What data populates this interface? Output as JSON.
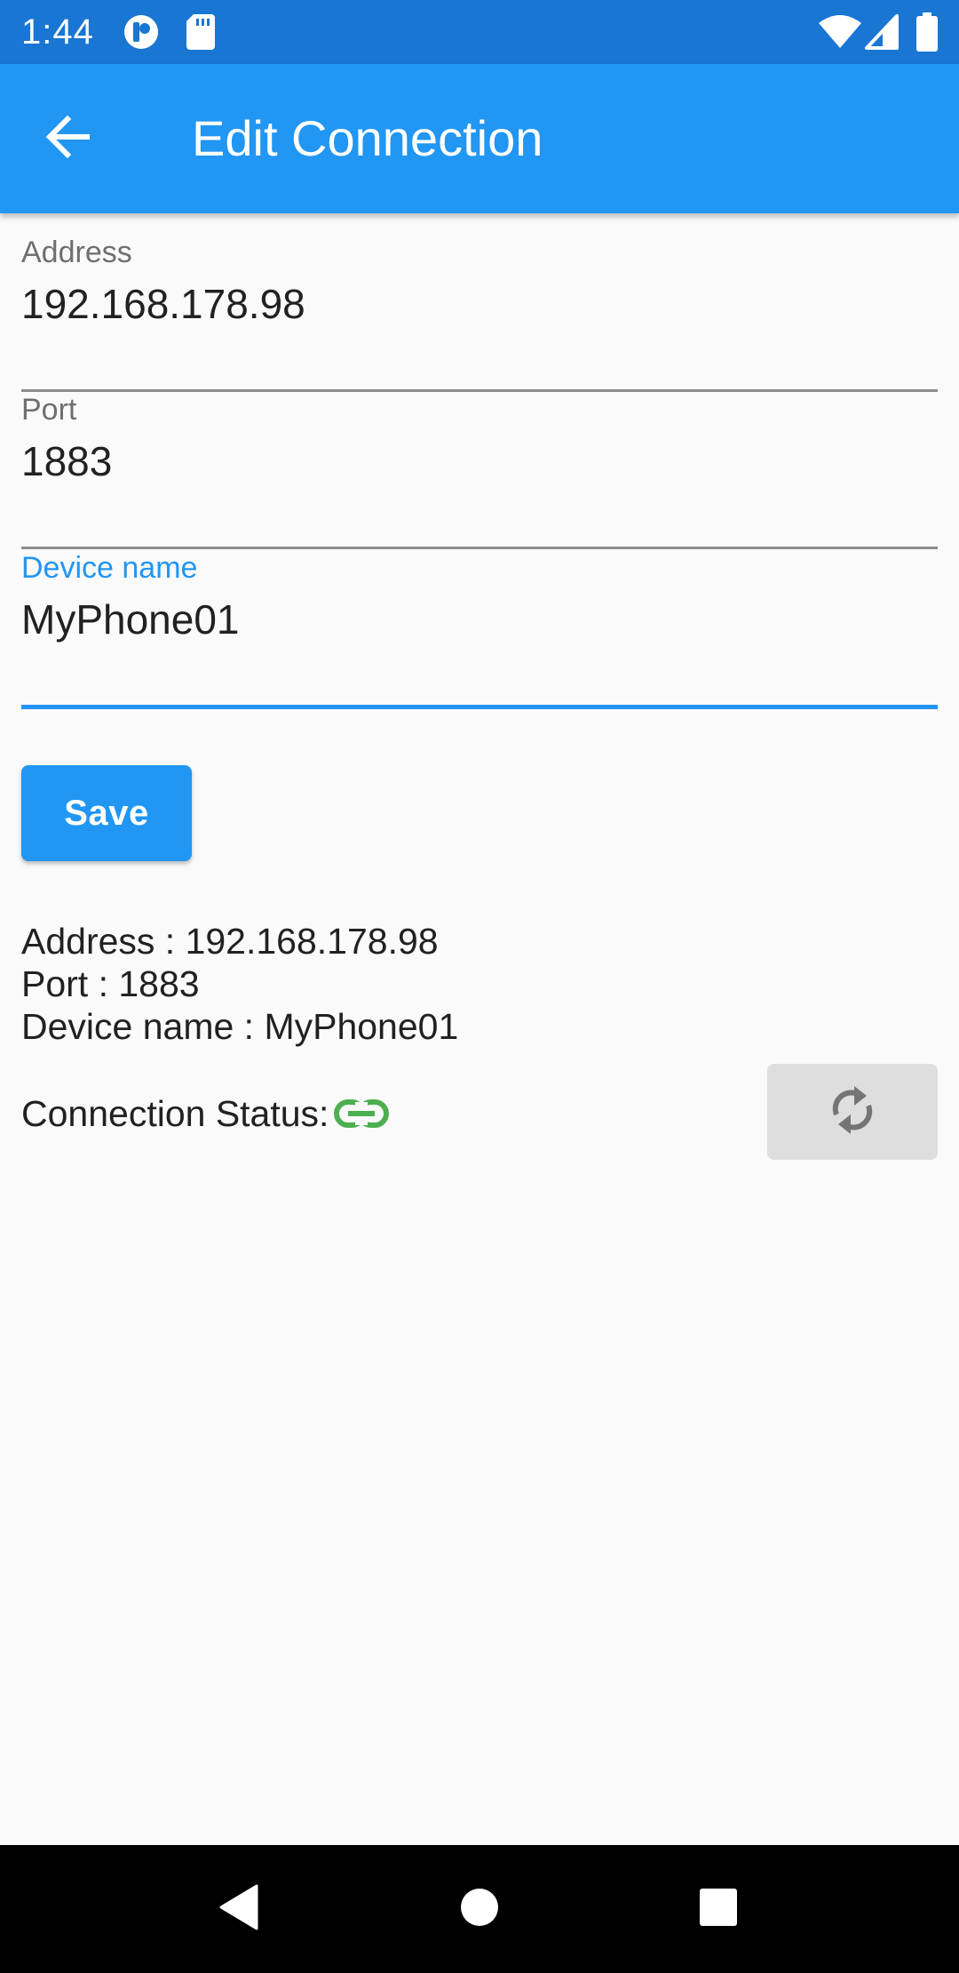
{
  "status_bar": {
    "time": "1:44",
    "icons": [
      "notification-app-icon",
      "sd-card-icon",
      "wifi-icon",
      "cell-signal-icon",
      "battery-icon"
    ],
    "background": "#1976d2"
  },
  "app_bar": {
    "title": "Edit Connection",
    "back_icon": "arrow-back-icon",
    "background": "#2196f3"
  },
  "form": {
    "fields": [
      {
        "label": "Address",
        "value": "192.168.178.98",
        "focused": false
      },
      {
        "label": "Port",
        "value": "1883",
        "focused": false
      },
      {
        "label": "Device name",
        "value": "MyPhone01",
        "focused": true
      }
    ],
    "save_label": "Save"
  },
  "summary": {
    "address_line": "Address : 192.168.178.98",
    "port_line": "Port : 1883",
    "device_line": "Device name : MyPhone01"
  },
  "connection": {
    "status_label": "Connection Status:",
    "status_icon": "link-icon",
    "status_color": "#4caf50",
    "refresh_icon": "sync-icon"
  },
  "nav_bar": {
    "buttons": [
      "back-triangle-icon",
      "home-circle-icon",
      "recents-square-icon"
    ]
  },
  "colors": {
    "accent": "#2196f3",
    "disabled_button": "#dedede"
  }
}
